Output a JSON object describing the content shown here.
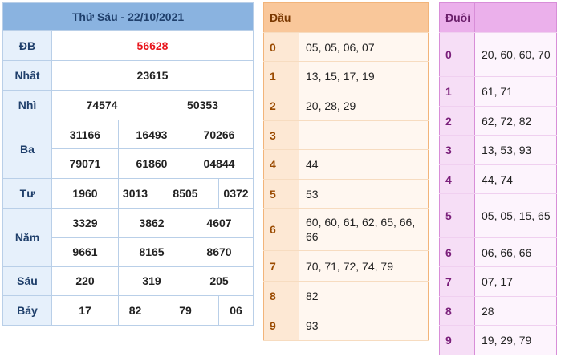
{
  "results": {
    "title": "Thứ Sáu - 22/10/2021",
    "db": {
      "label": "ĐB",
      "values": [
        "56628"
      ]
    },
    "nhat": {
      "label": "Nhất",
      "values": [
        "23615"
      ]
    },
    "nhi": {
      "label": "Nhì",
      "values": [
        "74574",
        "50353"
      ]
    },
    "ba": {
      "label": "Ba",
      "row1": [
        "31166",
        "16493",
        "70266"
      ],
      "row2": [
        "79071",
        "61860",
        "04844"
      ]
    },
    "tu": {
      "label": "Tư",
      "values": [
        "1960",
        "3013",
        "8505",
        "0372"
      ]
    },
    "nam": {
      "label": "Năm",
      "row1": [
        "3329",
        "3862",
        "4607"
      ],
      "row2": [
        "9661",
        "8165",
        "8670"
      ]
    },
    "sau": {
      "label": "Sáu",
      "values": [
        "220",
        "319",
        "205"
      ]
    },
    "bay": {
      "label": "Bảy",
      "values": [
        "17",
        "82",
        "79",
        "06"
      ]
    }
  },
  "dau": {
    "header": "Đầu",
    "rows": [
      {
        "key": "0",
        "value": "05, 05, 06, 07"
      },
      {
        "key": "1",
        "value": "13, 15, 17, 19"
      },
      {
        "key": "2",
        "value": "20, 28, 29"
      },
      {
        "key": "3",
        "value": ""
      },
      {
        "key": "4",
        "value": "44"
      },
      {
        "key": "5",
        "value": "53"
      },
      {
        "key": "6",
        "value": "60, 60, 61, 62, 65, 66, 66"
      },
      {
        "key": "7",
        "value": "70, 71, 72, 74, 79"
      },
      {
        "key": "8",
        "value": "82"
      },
      {
        "key": "9",
        "value": "93"
      }
    ]
  },
  "duoi": {
    "header": "Đuôi",
    "rows": [
      {
        "key": "0",
        "value": "20, 60, 60, 70"
      },
      {
        "key": "1",
        "value": "61, 71"
      },
      {
        "key": "2",
        "value": "62, 72, 82"
      },
      {
        "key": "3",
        "value": "13, 53, 93"
      },
      {
        "key": "4",
        "value": "44, 74"
      },
      {
        "key": "5",
        "value": "05, 05, 15, 65"
      },
      {
        "key": "6",
        "value": "06, 66, 66"
      },
      {
        "key": "7",
        "value": "07, 17"
      },
      {
        "key": "8",
        "value": "28"
      },
      {
        "key": "9",
        "value": "19, 29, 79"
      }
    ]
  }
}
